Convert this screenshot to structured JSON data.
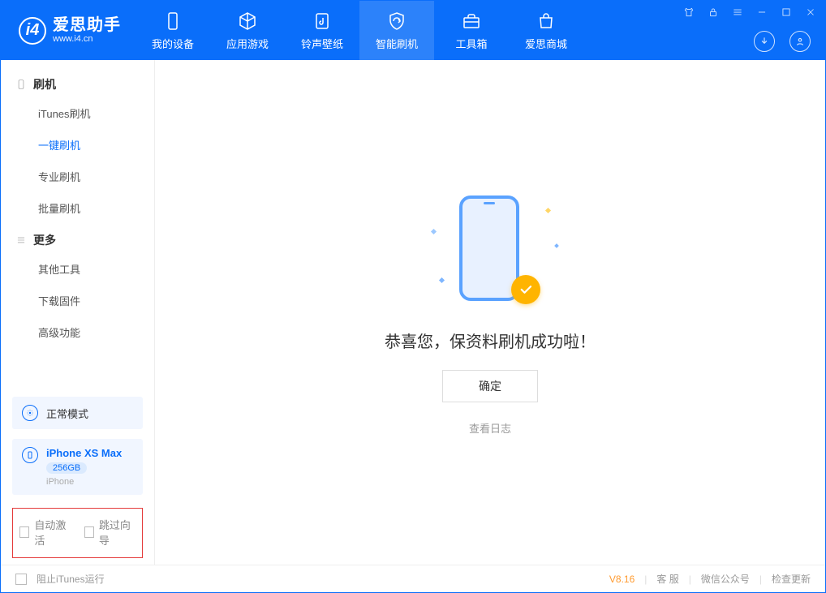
{
  "logo": {
    "name": "爱思助手",
    "url": "www.i4.cn"
  },
  "tabs": [
    {
      "label": "我的设备"
    },
    {
      "label": "应用游戏"
    },
    {
      "label": "铃声壁纸"
    },
    {
      "label": "智能刷机"
    },
    {
      "label": "工具箱"
    },
    {
      "label": "爱思商城"
    }
  ],
  "sidebar": {
    "section1": {
      "title": "刷机",
      "items": [
        "iTunes刷机",
        "一键刷机",
        "专业刷机",
        "批量刷机"
      ]
    },
    "section2": {
      "title": "更多",
      "items": [
        "其他工具",
        "下载固件",
        "高级功能"
      ]
    }
  },
  "mode": {
    "label": "正常模式"
  },
  "device": {
    "name": "iPhone XS Max",
    "storage": "256GB",
    "type": "iPhone"
  },
  "highlight": {
    "chk1": "自动激活",
    "chk2": "跳过向导"
  },
  "main": {
    "success_text": "恭喜您，保资料刷机成功啦！",
    "ok_label": "确定",
    "view_log": "查看日志"
  },
  "status": {
    "prevent_itunes": "阻止iTunes运行",
    "version": "V8.16",
    "customer_service": "客 服",
    "wechat": "微信公众号",
    "check_update": "检查更新"
  }
}
